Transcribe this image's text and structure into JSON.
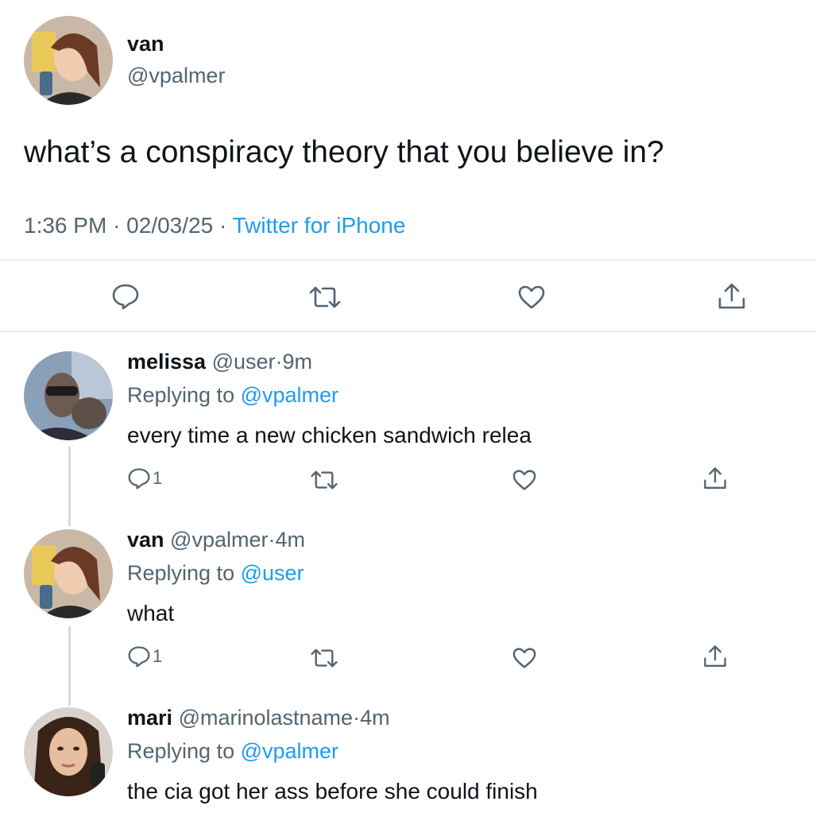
{
  "main_tweet": {
    "author_name": "van",
    "author_handle": "@vpalmer",
    "text": "what’s a conspiracy theory that you believe in?",
    "time": "1:36 PM",
    "date": "02/03/25",
    "separator": "·",
    "source": "Twitter for iPhone",
    "actions": [
      "reply-icon",
      "retweet-icon",
      "like-icon",
      "share-icon"
    ]
  },
  "replies": [
    {
      "name": "melissa",
      "handle": "@user",
      "dot": "·",
      "time": "9m",
      "replying_prefix": "Replying to",
      "replying_to": "@vpalmer",
      "text": "every time a new chicken sandwich relea",
      "reply_count": "1"
    },
    {
      "name": "van",
      "handle": "@vpalmer",
      "dot": "·",
      "time": "4m",
      "replying_prefix": "Replying to",
      "replying_to": "@user",
      "text": "what",
      "reply_count": "1"
    },
    {
      "name": "mari",
      "handle": "@marinolastname",
      "dot": "·",
      "time": "4m",
      "replying_prefix": "Replying to",
      "replying_to": "@vpalmer",
      "text": "the cia got her ass before she could finish"
    }
  ],
  "colors": {
    "link_blue": "#1d9bf0",
    "secondary_grey": "#536471",
    "divider": "#e6ecf0"
  }
}
